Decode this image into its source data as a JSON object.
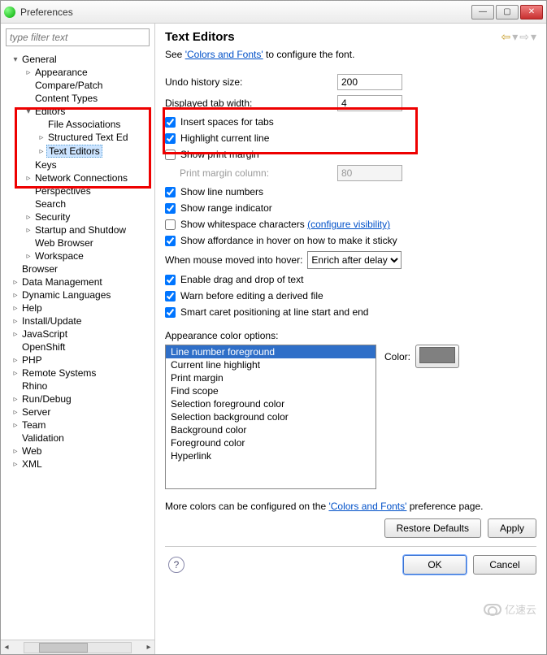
{
  "window": {
    "title": "Preferences"
  },
  "filter": {
    "placeholder": "type filter text"
  },
  "tree": {
    "items": [
      {
        "label": "General",
        "depth": 0,
        "arrow": "▾"
      },
      {
        "label": "Appearance",
        "depth": 1,
        "arrow": "▹"
      },
      {
        "label": "Compare/Patch",
        "depth": 1,
        "arrow": ""
      },
      {
        "label": "Content Types",
        "depth": 1,
        "arrow": ""
      },
      {
        "label": "Editors",
        "depth": 1,
        "arrow": "▾"
      },
      {
        "label": "File Associations",
        "depth": 2,
        "arrow": ""
      },
      {
        "label": "Structured Text Ed",
        "depth": 2,
        "arrow": "▹"
      },
      {
        "label": "Text Editors",
        "depth": 2,
        "arrow": "▹",
        "selected": true
      },
      {
        "label": "Keys",
        "depth": 1,
        "arrow": ""
      },
      {
        "label": "Network Connections",
        "depth": 1,
        "arrow": "▹"
      },
      {
        "label": "Perspectives",
        "depth": 1,
        "arrow": ""
      },
      {
        "label": "Search",
        "depth": 1,
        "arrow": ""
      },
      {
        "label": "Security",
        "depth": 1,
        "arrow": "▹"
      },
      {
        "label": "Startup and Shutdow",
        "depth": 1,
        "arrow": "▹"
      },
      {
        "label": "Web Browser",
        "depth": 1,
        "arrow": ""
      },
      {
        "label": "Workspace",
        "depth": 1,
        "arrow": "▹"
      },
      {
        "label": "Browser",
        "depth": 0,
        "arrow": ""
      },
      {
        "label": "Data Management",
        "depth": 0,
        "arrow": "▹"
      },
      {
        "label": "Dynamic Languages",
        "depth": 0,
        "arrow": "▹"
      },
      {
        "label": "Help",
        "depth": 0,
        "arrow": "▹"
      },
      {
        "label": "Install/Update",
        "depth": 0,
        "arrow": "▹"
      },
      {
        "label": "JavaScript",
        "depth": 0,
        "arrow": "▹"
      },
      {
        "label": "OpenShift",
        "depth": 0,
        "arrow": ""
      },
      {
        "label": "PHP",
        "depth": 0,
        "arrow": "▹"
      },
      {
        "label": "Remote Systems",
        "depth": 0,
        "arrow": "▹"
      },
      {
        "label": "Rhino",
        "depth": 0,
        "arrow": ""
      },
      {
        "label": "Run/Debug",
        "depth": 0,
        "arrow": "▹"
      },
      {
        "label": "Server",
        "depth": 0,
        "arrow": "▹"
      },
      {
        "label": "Team",
        "depth": 0,
        "arrow": "▹"
      },
      {
        "label": "Validation",
        "depth": 0,
        "arrow": ""
      },
      {
        "label": "Web",
        "depth": 0,
        "arrow": "▹"
      },
      {
        "label": "XML",
        "depth": 0,
        "arrow": "▹"
      }
    ]
  },
  "page": {
    "heading": "Text Editors",
    "intro_prefix": "See ",
    "intro_link": "'Colors and Fonts'",
    "intro_suffix": " to configure the font.",
    "fields": {
      "undo_label": "Undo history size:",
      "undo_value": "200",
      "tabwidth_label": "Displayed tab width:",
      "tabwidth_value": "4",
      "printcol_label": "Print margin column:",
      "printcol_value": "80"
    },
    "checks": {
      "insert_spaces": "Insert spaces for tabs",
      "highlight_line": "Highlight current line",
      "show_print_margin": "Show print margin",
      "show_line_numbers": "Show line numbers",
      "show_range": "Show range indicator",
      "show_whitespace": "Show whitespace characters",
      "whitespace_link": "(configure visibility)",
      "affordance": "Show affordance in hover on how to make it sticky",
      "hover_label": "When mouse moved into hover:",
      "hover_value": "Enrich after delay",
      "enable_dnd": "Enable drag and drop of text",
      "warn_derived": "Warn before editing a derived file",
      "smart_caret": "Smart caret positioning at line start and end"
    },
    "appearance_label": "Appearance color options:",
    "color_label": "Color:",
    "color_options": [
      "Line number foreground",
      "Current line highlight",
      "Print margin",
      "Find scope",
      "Selection foreground color",
      "Selection background color",
      "Background color",
      "Foreground color",
      "Hyperlink"
    ],
    "more_colors_prefix": "More colors can be configured on the ",
    "more_colors_link": "'Colors and Fonts'",
    "more_colors_suffix": " preference page.",
    "buttons": {
      "restore": "Restore Defaults",
      "apply": "Apply",
      "ok": "OK",
      "cancel": "Cancel"
    }
  },
  "watermark": "亿速云"
}
